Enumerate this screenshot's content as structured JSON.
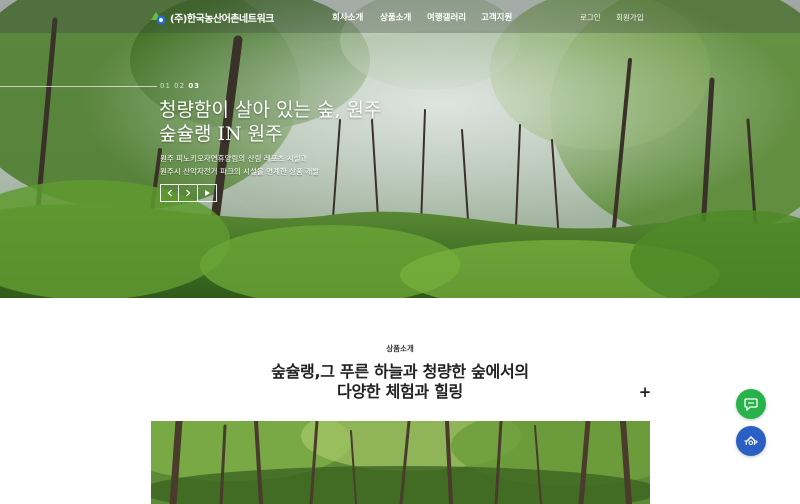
{
  "header": {
    "logo_text": "(주)한국농산어촌네트워크",
    "nav": [
      {
        "label": "회사소개"
      },
      {
        "label": "상품소개"
      },
      {
        "label": "여행갤러리"
      },
      {
        "label": "고객지원"
      }
    ],
    "util": [
      {
        "label": "로그인"
      },
      {
        "label": "회원가입"
      }
    ]
  },
  "hero": {
    "pager": {
      "items": [
        "01",
        "02",
        "03"
      ],
      "active_index": 2
    },
    "title_line1": "청량함이 살아 있는 숲, 원주",
    "title_line2": "숲슐랭 IN 원주",
    "desc_line1": "원주 피노키오자연휴양림의 산림 레포츠 시설과",
    "desc_line2": "원주시 산악자전거 파크의 시설을 연계한 상품 개발",
    "controls": {
      "prev_icon": "chevron-left-icon",
      "next_icon": "chevron-right-icon",
      "play_icon": "play-icon"
    }
  },
  "section": {
    "label": "상품소개",
    "title_line1": "숲슐랭,그 푸른 하늘과 청량한 숲에서의",
    "title_line2": "다양한 체험과 힐링",
    "more_label": "+"
  },
  "floating": {
    "chat_icon": "chat-icon",
    "top_label": "TOP"
  },
  "colors": {
    "chat_button": "#27b34a",
    "top_button": "#2a5fc4",
    "logo_green": "#6cbf3c",
    "logo_blue": "#1f6fd1"
  }
}
